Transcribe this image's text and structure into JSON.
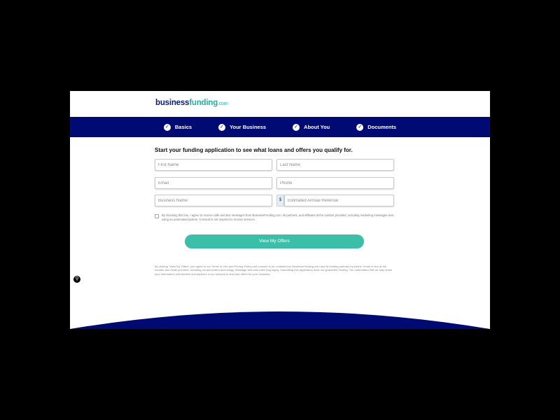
{
  "brand": {
    "logo_part1": "business",
    "logo_part2": "funding",
    "logo_part3": ".com"
  },
  "steps": [
    {
      "label": "Basics"
    },
    {
      "label": "Your Business"
    },
    {
      "label": "About You"
    },
    {
      "label": "Documents"
    }
  ],
  "form": {
    "title": "Start your funding application to see what loans and offers you qualify for.",
    "first_name_placeholder": "First Name",
    "last_name_placeholder": "Last Name",
    "email_placeholder": "Email",
    "phone_placeholder": "Phone",
    "business_name_placeholder": "Business Name",
    "currency_symbol": "$",
    "revenue_placeholder": "Estimated Annual Revenue",
    "consent_text": "By checking this box, I agree to receive calls and text messages from BusinessFunding.com, its partners, and affiliates at the number provided, including marketing messages sent using an automated system. Consent is not required to receive services.",
    "submit_label": "View My Offers",
    "disclaimer": "By clicking \"View My Offers\" you agree to our Terms of Use and Privacy Policy and consent to be contacted by BusinessFunding.com and its lending partners by phone, email or text at the number and email provided, including via automated technology. Message and data rates may apply. Submitting this application does not guarantee funding. You understand that we may share your information with lenders and partners in our network to find loan offers for your business."
  },
  "colors": {
    "nav_bg": "#000a73",
    "accent": "#3cbfa8",
    "brand_navy": "#0b1a72",
    "brand_teal": "#1fb3a0"
  }
}
